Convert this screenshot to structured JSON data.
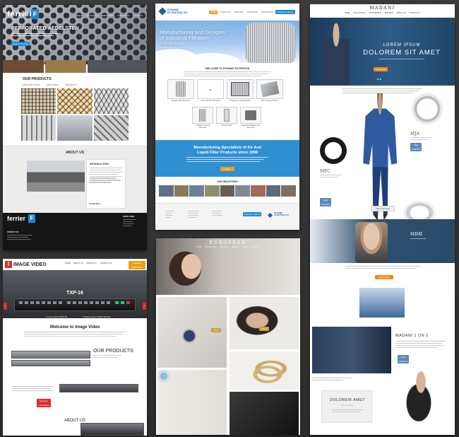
{
  "ferrier": {
    "logo": "ferrier",
    "logo_mark": "F",
    "nav": [
      "ABOUT",
      "PRODUCTS",
      "INDUSTRIES",
      "PROJECTS",
      "CONTACT"
    ],
    "hero_title": "PERFORATED AEDELSTEN",
    "hero_button": "Explore Products",
    "products_title": "OUR PRODUCTS",
    "product_tabs": [
      "ARCHITECTURAL",
      "INDUSTRIAL",
      "PROJECTS"
    ],
    "about_title": "ABOUT US",
    "intro_title": "INTRODUCTION",
    "read_more": "Read More",
    "footer_logo": "ferrier",
    "footer_contact": "CONTACT US",
    "footer_quick": "QUICK LINKS"
  },
  "dynamic": {
    "logo_line1": "DYNAMIC",
    "logo_line2": "FILTRATION LTD.",
    "nav": [
      "HOME",
      "PRODUCTS",
      "SERVICES",
      "INDUSTRIES",
      "RESOURCES",
      "CONTACT US"
    ],
    "cta": "Request a Quote",
    "hero_title_1": "Manufacturing and Designer",
    "hero_title_2": "of Industrial Filtration",
    "hero_sub_1": "for Air and Liquid",
    "hero_sub_2": "Applications",
    "welcome": "WELCOME TO DYNAMIC FILTRATION",
    "products": [
      "Absolute Filter Elements",
      "Glass and Filter Elements",
      "Replacement Pleated Filters",
      "Paint Spray and Filters",
      "Cartridge Filter and Elements",
      "Rolls & Media",
      "Separator Filtration Units Elements"
    ],
    "band_title_1": "Manufacturing Specialists of Air And",
    "band_title_2": "Liquid Filter Products since 1998",
    "band_button": "More",
    "industries_title": "OUR INDUSTRIES"
  },
  "madani": {
    "logo": "MADANI",
    "nav": [
      "HOME",
      "COLLECTIONS",
      "ENGAGEMENT",
      "WEDDING",
      "ABOUT US",
      "CONTACT US"
    ],
    "hero_line1": "LOREM IPSUM",
    "hero_line2": "DOLOREM SIT AMET",
    "hero_button": "Shop Now",
    "ring1": "MJA",
    "ring2": "MFC",
    "ring3": "MMM",
    "section_button": "View Collection",
    "mimi": "MIMI",
    "orange_button": "Learn More",
    "one_on_one": "MADANI 1 ON 1",
    "dolor": "DOLOREM AMET",
    "dolor_sub": "Lorem Ipsum"
  },
  "imagevideo": {
    "logo_mark": "I",
    "logo": "IMAGE VIDEO",
    "nav": [
      "HOME",
      "ABOUT US",
      "PRODUCTS",
      "CONTACT US"
    ],
    "cta": "Request Information",
    "hero_title": "TXP-16",
    "check1": "✓ Lorem Ipsum Dolor Sit",
    "check2": "✓ Dolorem Ipsum Dolor Sit Amet",
    "welcome": "Welcome to Image Video",
    "products": "OUR PRODUCTS",
    "about": "ABOUT US"
  },
  "european": {
    "logo": "EUROPEAN",
    "nav": [
      "HOME",
      "COLLECTIONS",
      "WATCHES",
      "JEWELRY",
      "ABOUT",
      "CONTACT"
    ],
    "tile_button": "Shop"
  },
  "colors": {
    "ferrier_blue": "#1e88d3",
    "dynamic_blue": "#2f8fd1",
    "dynamic_orange": "#f0a21f",
    "madani_orange": "#f08a1c",
    "imagevideo_red": "#e02a2a",
    "european_gold": "#c4a23b"
  }
}
